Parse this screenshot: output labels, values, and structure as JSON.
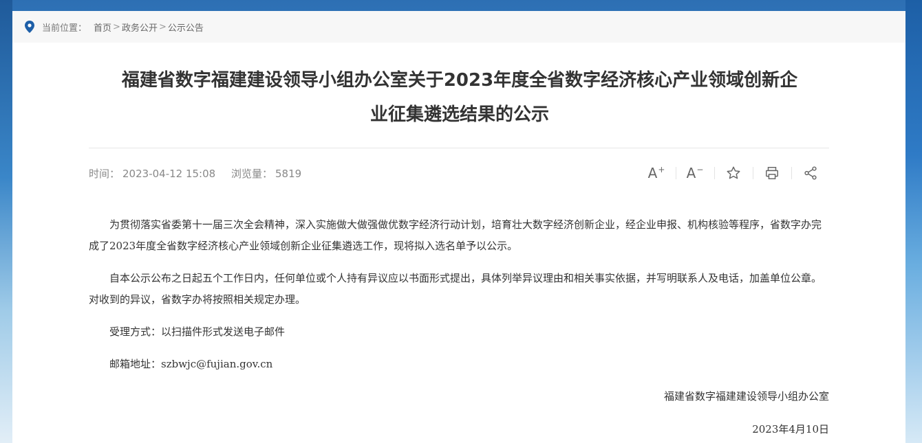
{
  "breadcrumb": {
    "label": "当前位置：",
    "items": [
      "首页",
      "政务公开",
      "公示公告"
    ],
    "separator": ">"
  },
  "article": {
    "title_line1": "福建省数字福建建设领导小组办公室关于2023年度全省数字经济核心产业领域创新企",
    "title_line2": "业征集遴选结果的公示",
    "time_label": "时间：",
    "time_value": "2023-04-12 15:08",
    "views_label": "浏览量：",
    "views_value": "5819",
    "paragraphs": [
      "为贯彻落实省委第十一届三次全会精神，深入实施做大做强做优数字经济行动计划，培育壮大数字经济创新企业，经企业申报、机构核验等程序，省数字办完成了2023年度全省数字经济核心产业领域创新企业征集遴选工作，现将拟入选名单予以公示。",
      "自本公示公布之日起五个工作日内，任何单位或个人持有异议应以书面形式提出，具体列举异议理由和相关事实依据，并写明联系人及电话，加盖单位公章。对收到的异议，省数字办将按照相关规定办理。",
      "受理方式：以扫描件形式发送电子邮件",
      "邮箱地址：szbwjc@fujian.gov.cn"
    ],
    "signature": "福建省数字福建建设领导小组办公室",
    "date": "2023年4月10日"
  },
  "tools": {
    "font_increase": "A",
    "font_decrease": "A",
    "font_increase_mark": "+",
    "font_decrease_mark": "−",
    "icons": [
      "font-increase-icon",
      "font-decrease-icon",
      "star-icon",
      "print-icon",
      "share-icon"
    ]
  },
  "colors": {
    "accent": "#1e6fc1",
    "text": "#333333",
    "muted": "#888888"
  }
}
